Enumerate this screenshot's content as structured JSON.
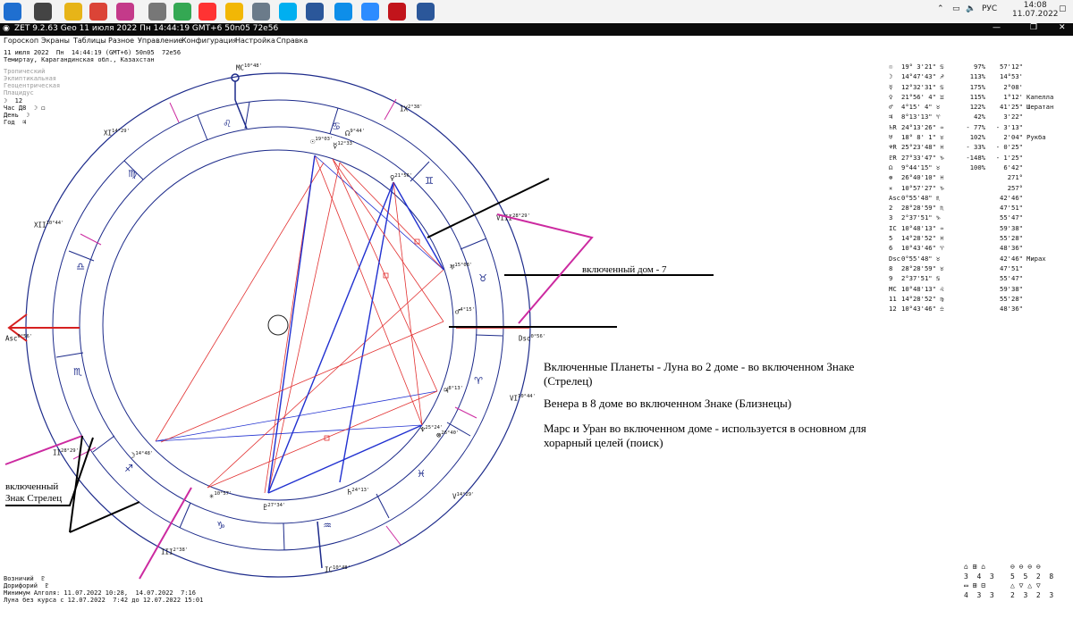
{
  "taskbar": {
    "apps": [
      {
        "icon": "windows-start-icon",
        "color": "#1f6fd0"
      },
      {
        "icon": "task-view-icon",
        "color": "#444444"
      },
      {
        "icon": "file-explorer-icon",
        "color": "#e7b418"
      },
      {
        "icon": "chrome-icon",
        "color": "#db4437"
      },
      {
        "icon": "photos-icon",
        "color": "#c43a8a"
      },
      {
        "icon": "printer-icon",
        "color": "#777777"
      },
      {
        "icon": "chart-app-icon",
        "color": "#34a853"
      },
      {
        "icon": "yandex-icon",
        "color": "#ff3333"
      },
      {
        "icon": "sun-app-icon",
        "color": "#f2b705"
      },
      {
        "icon": "settings-app-icon",
        "color": "#6b7b8a"
      },
      {
        "icon": "skype-icon",
        "color": "#00aff0"
      },
      {
        "icon": "vpn-icon",
        "color": "#2b579a"
      },
      {
        "icon": "teamviewer-icon",
        "color": "#0e8ee9"
      },
      {
        "icon": "zoom-icon",
        "color": "#2d8cff"
      },
      {
        "icon": "media-app-icon",
        "color": "#c2141b"
      },
      {
        "icon": "word-icon",
        "color": "#2b579a"
      }
    ],
    "tray_lang": "РУС",
    "time": "14:08",
    "date": "11.07.2022"
  },
  "titlebar": {
    "text": "ZET 9.2.63 Geo   11 июля 2022  Пн  14:44:19 GMT+6 50n05  72e56"
  },
  "menu": [
    "Гороскоп",
    "Экраны",
    "Таблицы",
    "Разное",
    "Управление",
    "Конфигурация",
    "Настройка",
    "Справка"
  ],
  "header": {
    "line1": "11 июля 2022  Пн  14:44:19 (GMT+6) 50n05  72e56",
    "line2": "Темиртау, Карагандинская обл., Казахстан"
  },
  "settings": [
    "Тропический",
    "Эклиптикальная",
    "Геоцентрическая",
    "Плацидус"
  ],
  "info": [
    "☽  12",
    "Час Д8  ☽ ◻",
    "День  ☽",
    "Год  ♃"
  ],
  "chart_labels": {
    "mc": "MC",
    "mc_deg": "10°48'",
    "ic": "IC",
    "ic_deg": "10°48'",
    "asc": "Asc",
    "asc_deg": "0°56'",
    "dsc": "Dsc",
    "dsc_deg": "0°56'",
    "ix": "IX",
    "ix_deg": "2°38'",
    "xi": "XI",
    "xi_deg": "14°29'",
    "xii": "XII",
    "xii_deg": "10°44'",
    "viii": "VIII",
    "viii_deg": "28°29'",
    "vi": "VI",
    "vi_deg": "10°44'",
    "v": "V",
    "v_deg": "14°29'",
    "ii": "II",
    "ii_deg": "28°29'",
    "iii": "III",
    "iii_deg": "2°38'"
  },
  "planet_marks": [
    {
      "g": "☉",
      "d": "19°03'"
    },
    {
      "g": "☿",
      "d": "12°33'"
    },
    {
      "g": "☊",
      "d": "9°44'"
    },
    {
      "g": "♀",
      "d": "21°56'"
    },
    {
      "g": "♅",
      "d": "15°08'"
    },
    {
      "g": "♂",
      "d": "4°15'"
    },
    {
      "g": "♃",
      "d": "8°13'"
    },
    {
      "g": "♆",
      "d": "25°24'"
    },
    {
      "g": "⊗",
      "d": "26°40'"
    },
    {
      "g": "♄",
      "d": "24°13'"
    },
    {
      "g": "♇",
      "d": "27°34'"
    },
    {
      "g": "✳",
      "d": "10°57'"
    },
    {
      "g": "☽",
      "d": "14°48'"
    }
  ],
  "annotations": {
    "house_label": "включенный дом - 7",
    "sign_label1": "включенный",
    "sign_label2": "Знак Стрелец",
    "p1a": "Включенные Планеты - Луна во 2 доме - во включенном Знаке",
    "p1b": "(Стрелец)",
    "p2": "Венера в 8 доме во включенном Знаке (Близнецы)",
    "p3a": "Марс и Уран во включенном доме - используется в основном для",
    "p3b": "хорарный целей (поиск)"
  },
  "table": [
    {
      "g": "☉",
      "pos": "19° 3'21\" ♋",
      "pct": "97%",
      "spd": "57'12\"",
      "note": ""
    },
    {
      "g": "☽",
      "pos": "14°47'43\" ♐",
      "pct": "113%",
      "spd": "14°53'",
      "note": ""
    },
    {
      "g": "☿",
      "pos": "12°32'31\" ♋",
      "pct": "175%",
      "spd": "2°08'",
      "note": ""
    },
    {
      "g": "♀",
      "pos": "21°56' 4\" ♊",
      "pct": "115%",
      "spd": "1°12'",
      "note": "Капелла"
    },
    {
      "g": "♂",
      "pos": "4°15' 4\" ♉",
      "pct": "122%",
      "spd": "41'25\"",
      "note": "Шератан"
    },
    {
      "g": "♃",
      "pos": "8°13'13\" ♈",
      "pct": "42%",
      "spd": "3'22\"",
      "note": ""
    },
    {
      "g": "♄R",
      "pos": "24°13'26\" ♒",
      "pct": "- 77%",
      "spd": "- 3'13\"",
      "note": ""
    },
    {
      "g": "♅",
      "pos": "18° 8' 1\" ♉",
      "pct": "102%",
      "spd": "2'04\"",
      "note": "Рукба"
    },
    {
      "g": "♆R",
      "pos": "25°23'48\" ♓",
      "pct": "- 33%",
      "spd": "- 0'25\"",
      "note": ""
    },
    {
      "g": "♇R",
      "pos": "27°33'47\" ♑",
      "pct": "-148%",
      "spd": "- 1'25\"",
      "note": ""
    },
    {
      "g": "☊",
      "pos": "9°44'15\" ♉",
      "pct": "100%",
      "spd": "6'42\"",
      "note": ""
    },
    {
      "g": "⊗",
      "pos": "26°40'10\" ♓",
      "pct": "",
      "spd": "271°",
      "note": ""
    },
    {
      "g": "✳",
      "pos": "10°57'27\" ♑",
      "pct": "",
      "spd": "257°",
      "note": ""
    },
    {
      "g": "Asc",
      "pos": "0°55'48\" ♏",
      "pct": "",
      "spd": "42'46\"",
      "note": ""
    },
    {
      "g": "2",
      "pos": "28°28'59\" ♏",
      "pct": "",
      "spd": "47'51\"",
      "note": ""
    },
    {
      "g": "3",
      "pos": "2°37'51\" ♑",
      "pct": "",
      "spd": "55'47\"",
      "note": ""
    },
    {
      "g": "IC",
      "pos": "10°48'13\" ♒",
      "pct": "",
      "spd": "59'38\"",
      "note": ""
    },
    {
      "g": "5",
      "pos": "14°28'52\" ♓",
      "pct": "",
      "spd": "55'28\"",
      "note": ""
    },
    {
      "g": "6",
      "pos": "10°43'46\" ♈",
      "pct": "",
      "spd": "48'36\"",
      "note": ""
    },
    {
      "g": "Dsc",
      "pos": "0°55'48\" ♉",
      "pct": "",
      "spd": "42'46\"",
      "note": "Мирах"
    },
    {
      "g": "8",
      "pos": "28°28'59\" ♉",
      "pct": "",
      "spd": "47'51\"",
      "note": ""
    },
    {
      "g": "9",
      "pos": "2°37'51\" ♋",
      "pct": "",
      "spd": "55'47\"",
      "note": ""
    },
    {
      "g": "MC",
      "pos": "10°48'13\" ♌",
      "pct": "",
      "spd": "59'38\"",
      "note": ""
    },
    {
      "g": "11",
      "pos": "14°28'52\" ♍",
      "pct": "",
      "spd": "55'28\"",
      "note": ""
    },
    {
      "g": "12",
      "pos": "10°43'46\" ♎",
      "pct": "",
      "spd": "48'36\"",
      "note": ""
    }
  ],
  "footer": {
    "l1": "Возничий  ♇",
    "l2": "Дорифорий  ♇",
    "l3": "Минимум Алголя: 11.07.2022 10:28,  14.07.2022  7:16",
    "l4": "Луна без курса с 12.07.2022  7:42 до 12.07.2022 15:01"
  },
  "stats": {
    "groupA": [
      "3",
      "4",
      "3"
    ],
    "groupA2": [
      "4",
      "3",
      "3"
    ],
    "groupB": [
      "5",
      "5",
      "2",
      "8"
    ],
    "groupB2": [
      "2",
      "3",
      "2",
      "3"
    ]
  }
}
